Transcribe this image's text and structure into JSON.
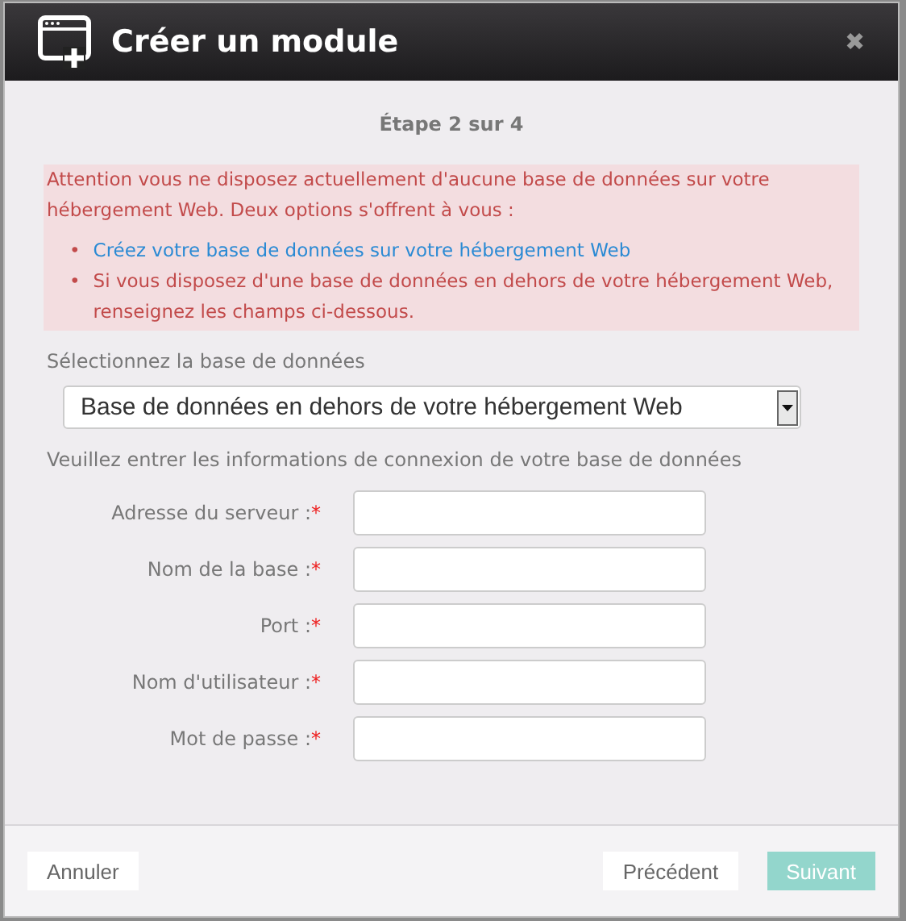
{
  "window": {
    "title": "Créer un module",
    "close": "✖"
  },
  "step": "Étape 2 sur 4",
  "alert": {
    "text": "Attention vous ne disposez actuellement d'aucune base de données sur votre hébergement Web. Deux options s'offrent à vous :",
    "items": [
      {
        "kind": "link",
        "bullet": "•",
        "text": "Créez votre base de données sur votre hébergement Web"
      },
      {
        "kind": "text",
        "bullet": "•",
        "text": "Si vous disposez d'une base de données en dehors de votre hébergement Web, renseignez les champs ci-dessous."
      }
    ]
  },
  "select": {
    "label": "Sélectionnez la base de données",
    "value": "Base de données en dehors de votre hébergement Web"
  },
  "connection_intro": "Veuillez entrer les informations de connexion de votre base de données",
  "fields": [
    {
      "label": "Adresse du serveur :",
      "mark": "*"
    },
    {
      "label": "Nom de la base :",
      "mark": "*"
    },
    {
      "label": "Port :",
      "mark": "*"
    },
    {
      "label": "Nom d'utilisateur :",
      "mark": "*"
    },
    {
      "label": "Mot de passe :",
      "mark": "*"
    }
  ],
  "buttons": [
    {
      "label": "Annuler",
      "kind": "plain",
      "disabled": false
    },
    {
      "label": "Précédent",
      "kind": "plain",
      "disabled": false
    },
    {
      "label": "Suivant",
      "kind": "primary",
      "disabled": true
    }
  ]
}
